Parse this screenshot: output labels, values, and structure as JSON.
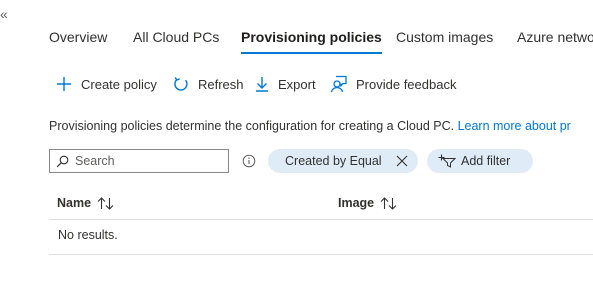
{
  "collapse_glyph": "«",
  "tabs": [
    {
      "label": "Overview",
      "active": false
    },
    {
      "label": "All Cloud PCs",
      "active": false
    },
    {
      "label": "Provisioning policies",
      "active": true
    },
    {
      "label": "Custom images",
      "active": false
    },
    {
      "label": "Azure netwo",
      "active": false
    }
  ],
  "toolbar": {
    "create": {
      "label": "Create policy",
      "icon": "plus-icon"
    },
    "refresh": {
      "label": "Refresh",
      "icon": "refresh-icon"
    },
    "export": {
      "label": "Export",
      "icon": "download-icon"
    },
    "feedback": {
      "label": "Provide feedback",
      "icon": "feedback-icon"
    }
  },
  "description": {
    "text": "Provisioning policies determine the configuration for creating a Cloud PC.",
    "link": "Learn more about pr"
  },
  "search": {
    "placeholder": "Search",
    "value": ""
  },
  "filters": {
    "active_filter": "Created by Equal",
    "add_filter": "Add filter"
  },
  "table": {
    "columns": [
      "Name",
      "Image"
    ],
    "empty_message": "No results."
  },
  "colors": {
    "accent": "#0078d4",
    "pill_bg": "#dfecf7",
    "border": "#e1dfdd"
  }
}
